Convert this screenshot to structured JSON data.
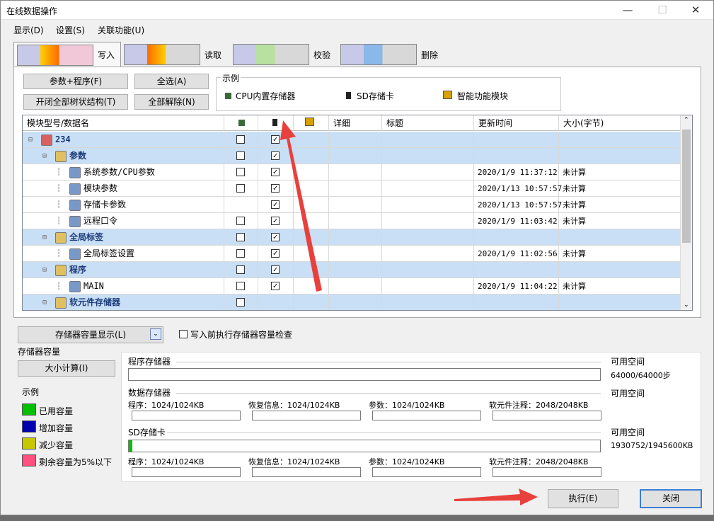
{
  "window": {
    "title": "在线数据操作",
    "minimize": "—",
    "maximize": "☐",
    "close": "✕"
  },
  "menu": [
    "显示(D)",
    "设置(S)",
    "关联功能(U)"
  ],
  "tabs": [
    {
      "label": "写入"
    },
    {
      "label": "读取"
    },
    {
      "label": "校验"
    },
    {
      "label": "删除"
    }
  ],
  "buttons": {
    "param_program": "参数+程序(F)",
    "select_all": "全选(A)",
    "toggle_tree": "开闭全部树状结构(T)",
    "deselect_all": "全部解除(N)"
  },
  "legend": {
    "title": "示例",
    "items": [
      "CPU内置存储器",
      "SD存储卡",
      "智能功能模块"
    ]
  },
  "grid": {
    "headers": [
      "模块型号/数据名",
      "",
      "",
      "",
      "详细",
      "标题",
      "更新时间",
      "大小(字节)"
    ],
    "rows": [
      {
        "name": "234",
        "level": 0,
        "bold": true,
        "hl": true,
        "cpu": false,
        "sd": true,
        "time": "",
        "size": ""
      },
      {
        "name": "参数",
        "level": 1,
        "bold": true,
        "hl": true,
        "cpu": false,
        "sd": true,
        "time": "",
        "size": ""
      },
      {
        "name": "系统参数/CPU参数",
        "level": 2,
        "bold": false,
        "hl": false,
        "cpu": false,
        "sd": true,
        "time": "2020/1/9 11:37:12",
        "size": "未计算"
      },
      {
        "name": "模块参数",
        "level": 2,
        "bold": false,
        "hl": false,
        "cpu": false,
        "sd": true,
        "time": "2020/1/13 10:57:57",
        "size": "未计算"
      },
      {
        "name": "存储卡参数",
        "level": 2,
        "bold": false,
        "hl": false,
        "cpu": null,
        "sd": true,
        "time": "2020/1/13 10:57:57",
        "size": "未计算"
      },
      {
        "name": "远程口令",
        "level": 2,
        "bold": false,
        "hl": false,
        "cpu": false,
        "sd": true,
        "time": "2020/1/9 11:03:42",
        "size": "未计算"
      },
      {
        "name": "全局标签",
        "level": 1,
        "bold": true,
        "hl": true,
        "cpu": false,
        "sd": true,
        "time": "",
        "size": ""
      },
      {
        "name": "全局标签设置",
        "level": 2,
        "bold": false,
        "hl": false,
        "cpu": false,
        "sd": true,
        "time": "2020/1/9 11:02:56",
        "size": "未计算"
      },
      {
        "name": "程序",
        "level": 1,
        "bold": true,
        "hl": true,
        "cpu": false,
        "sd": true,
        "time": "",
        "size": ""
      },
      {
        "name": "MAIN",
        "level": 2,
        "bold": false,
        "hl": false,
        "cpu": false,
        "sd": true,
        "time": "2020/1/9 11:04:22",
        "size": "未计算"
      },
      {
        "name": "软元件存储器",
        "level": 1,
        "bold": true,
        "hl": true,
        "cpu": false,
        "sd": null,
        "time": "",
        "size": ""
      }
    ]
  },
  "capacity": {
    "display_btn": "存储器容量显示(L)",
    "check_label": "写入前执行存储器容量检查",
    "title": "存储器容量",
    "calc_btn": "大小计算(I)",
    "legend_title": "示例",
    "legend": [
      {
        "label": "已用容量",
        "color": "#00c000"
      },
      {
        "label": "增加容量",
        "color": "#0000b0"
      },
      {
        "label": "减少容量",
        "color": "#c8c800"
      },
      {
        "label": "剩余容量为5%以下",
        "color": "#ff5080"
      }
    ],
    "program_memory": {
      "label": "程序存储器",
      "avail_label": "可用空间",
      "avail": "64000/64000步",
      "used_fraction": 0
    },
    "data_memory": {
      "label": "数据存储器",
      "avail_label": "可用空间",
      "items": [
        "程序：1024/1024KB",
        "恢复信息：1024/1024KB",
        "参数：1024/1024KB",
        "软元件注释：2048/2048KB"
      ]
    },
    "sd_card": {
      "label": "SD存储卡",
      "avail_label": "可用空间",
      "avail": "1930752/1945600KB",
      "used_fraction": 0.008,
      "items": [
        "程序：1024/1024KB",
        "恢复信息：1024/1024KB",
        "参数：1024/1024KB",
        "软元件注释：2048/2048KB"
      ]
    }
  },
  "footer": {
    "execute": "执行(E)",
    "close": "关闭"
  }
}
